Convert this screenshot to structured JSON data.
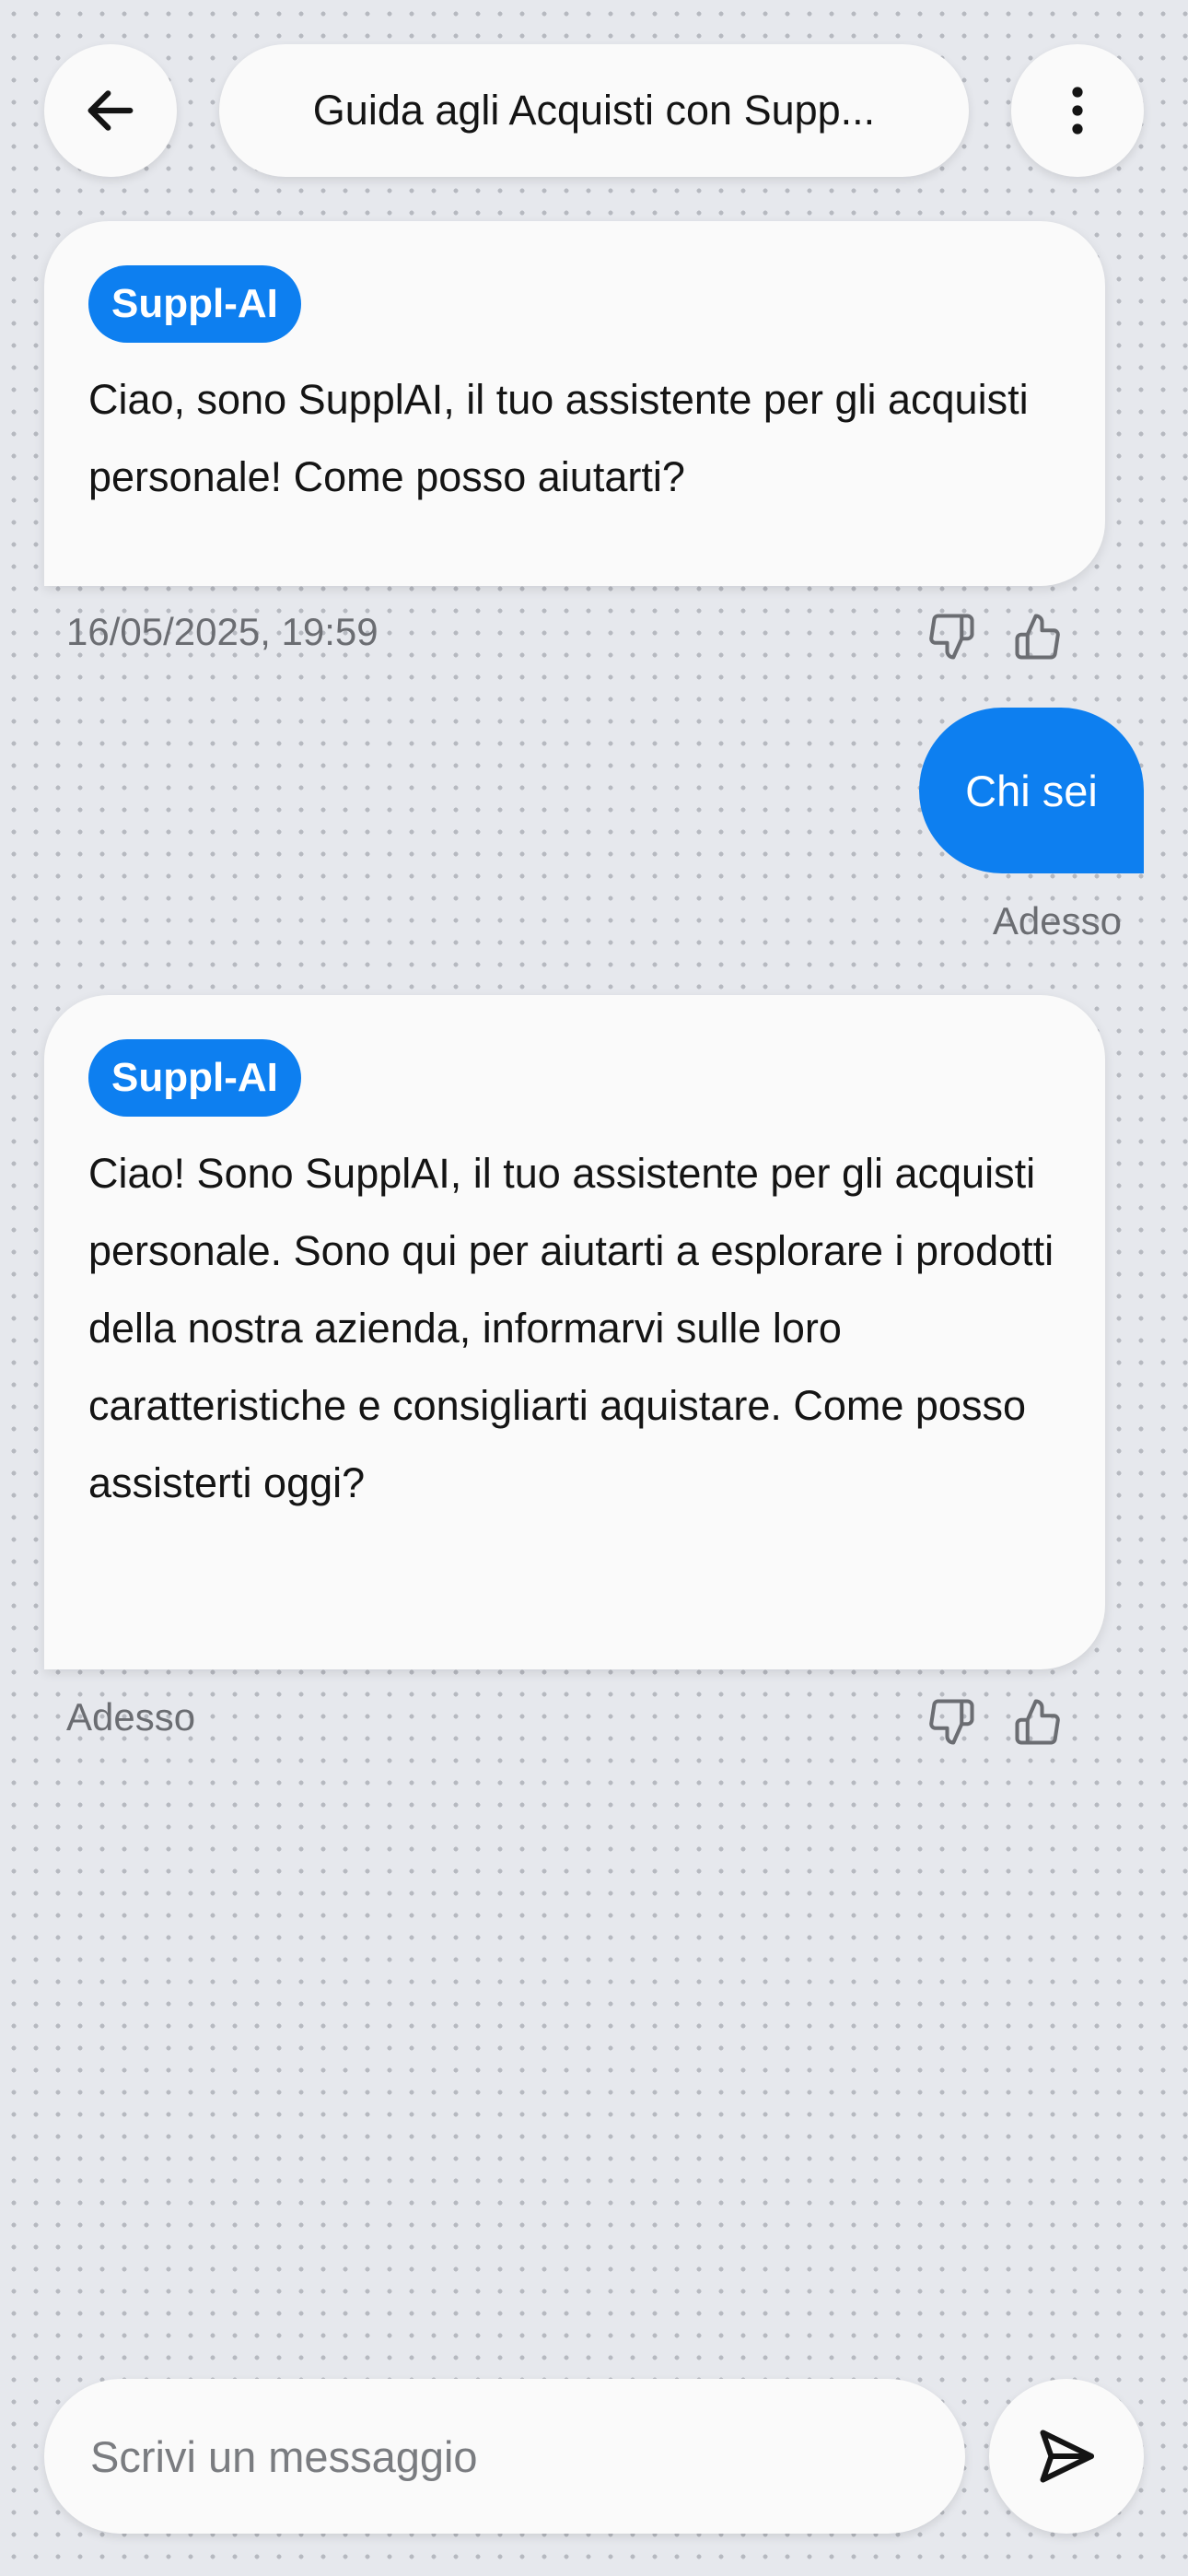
{
  "header": {
    "title": "Guida agli Acquisti con Supp...",
    "back_icon": "arrow-left-icon",
    "menu_icon": "more-vertical-icon"
  },
  "messages": [
    {
      "sender": "bot",
      "badge": "Suppl-AI",
      "text": "Ciao, sono SupplAI, il tuo assistente per gli acquisti personale! Come posso aiutarti?",
      "time": "16/05/2025, 19:59"
    },
    {
      "sender": "user",
      "text": "Chi sei",
      "time": "Adesso"
    },
    {
      "sender": "bot",
      "badge": "Suppl-AI",
      "text": "Ciao! Sono SupplAI, il tuo assistente per gli acquisti personale. Sono qui per aiutarti a esplorare i prodotti della nostra azienda, informarvi sulle loro caratteristiche e consigliarti aquistare. Come posso assisterti oggi?",
      "time": "Adesso"
    }
  ],
  "composer": {
    "placeholder": "Scrivi un messaggio",
    "value": "",
    "send_icon": "send-icon"
  },
  "colors": {
    "accent": "#0d7ff0",
    "background": "#e6e8ed",
    "surface": "#fafafa",
    "muted_text": "#6b6d72"
  }
}
